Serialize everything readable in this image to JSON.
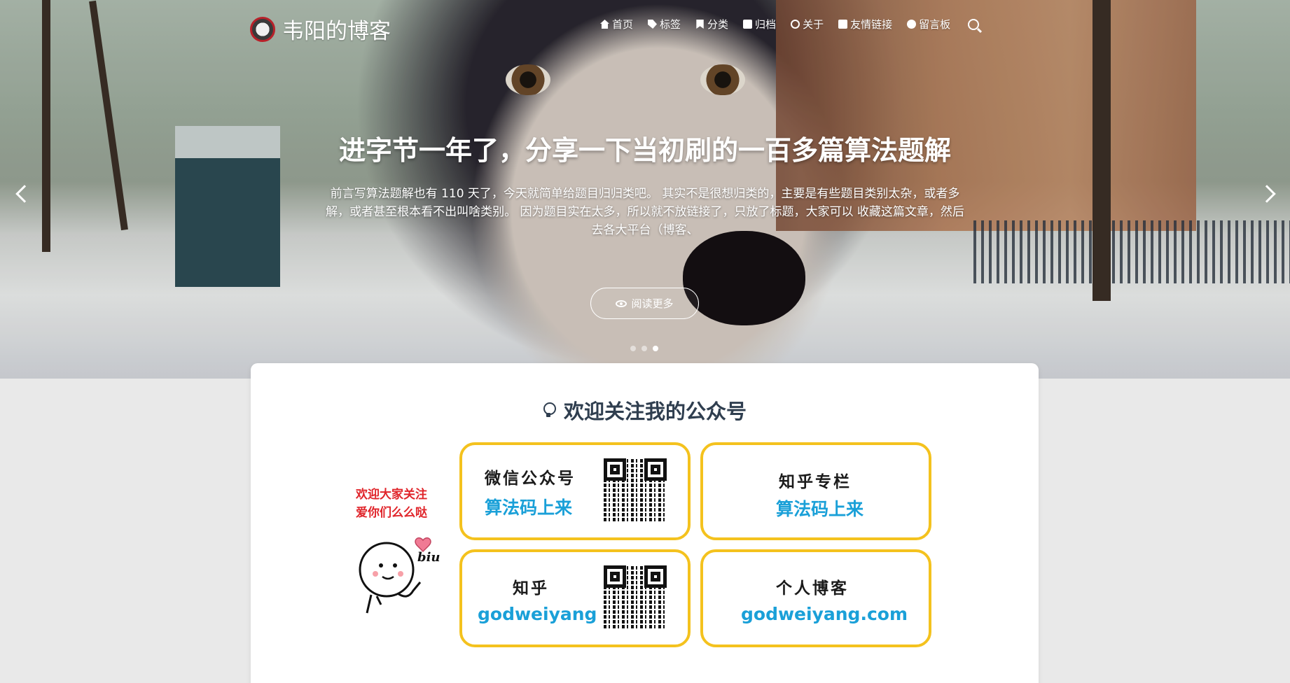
{
  "brand": {
    "title": "韦阳的博客"
  },
  "nav": [
    {
      "label": "首页",
      "icon": "home-icon"
    },
    {
      "label": "标签",
      "icon": "tags-icon"
    },
    {
      "label": "分类",
      "icon": "bookmark-icon"
    },
    {
      "label": "归档",
      "icon": "archive-icon"
    },
    {
      "label": "关于",
      "icon": "user-circle-icon"
    },
    {
      "label": "友情链接",
      "icon": "address-card-icon"
    },
    {
      "label": "留言板",
      "icon": "comments-icon"
    }
  ],
  "slide": {
    "title": "进字节一年了，分享一下当初刷的一百多篇算法题解",
    "excerpt": "前言写算法题解也有 110 天了，今天就简单给题目归归类吧。 其实不是很想归类的，主要是有些题目类别太杂，或者多解，或者甚至根本看不出叫啥类别。 因为题目实在太多，所以就不放链接了，只放了标题，大家可以 收藏这篇文章，然后去各大平台（博客、",
    "read_more": "阅读更多",
    "dots": 3,
    "active_dot": 3
  },
  "card": {
    "title": "欢迎关注我的公众号",
    "welcome_line1": "欢迎大家关注",
    "welcome_line2": "爱你们么么哒",
    "mascot_text": "biu",
    "boxes": [
      {
        "label": "微信公众号",
        "value": "算法码上来",
        "has_qr": true
      },
      {
        "label": "知乎专栏",
        "value": "算法码上来",
        "has_qr": false
      },
      {
        "label": "知乎",
        "value": "godweiyang",
        "has_qr": true
      },
      {
        "label": "个人博客",
        "value": "godweiyang.com",
        "has_qr": false
      }
    ]
  },
  "colors": {
    "accent_yellow": "#f4c21e",
    "link_blue": "#1aa0d8",
    "welcome_red": "#e0242a",
    "heading": "#2f3e4f"
  }
}
